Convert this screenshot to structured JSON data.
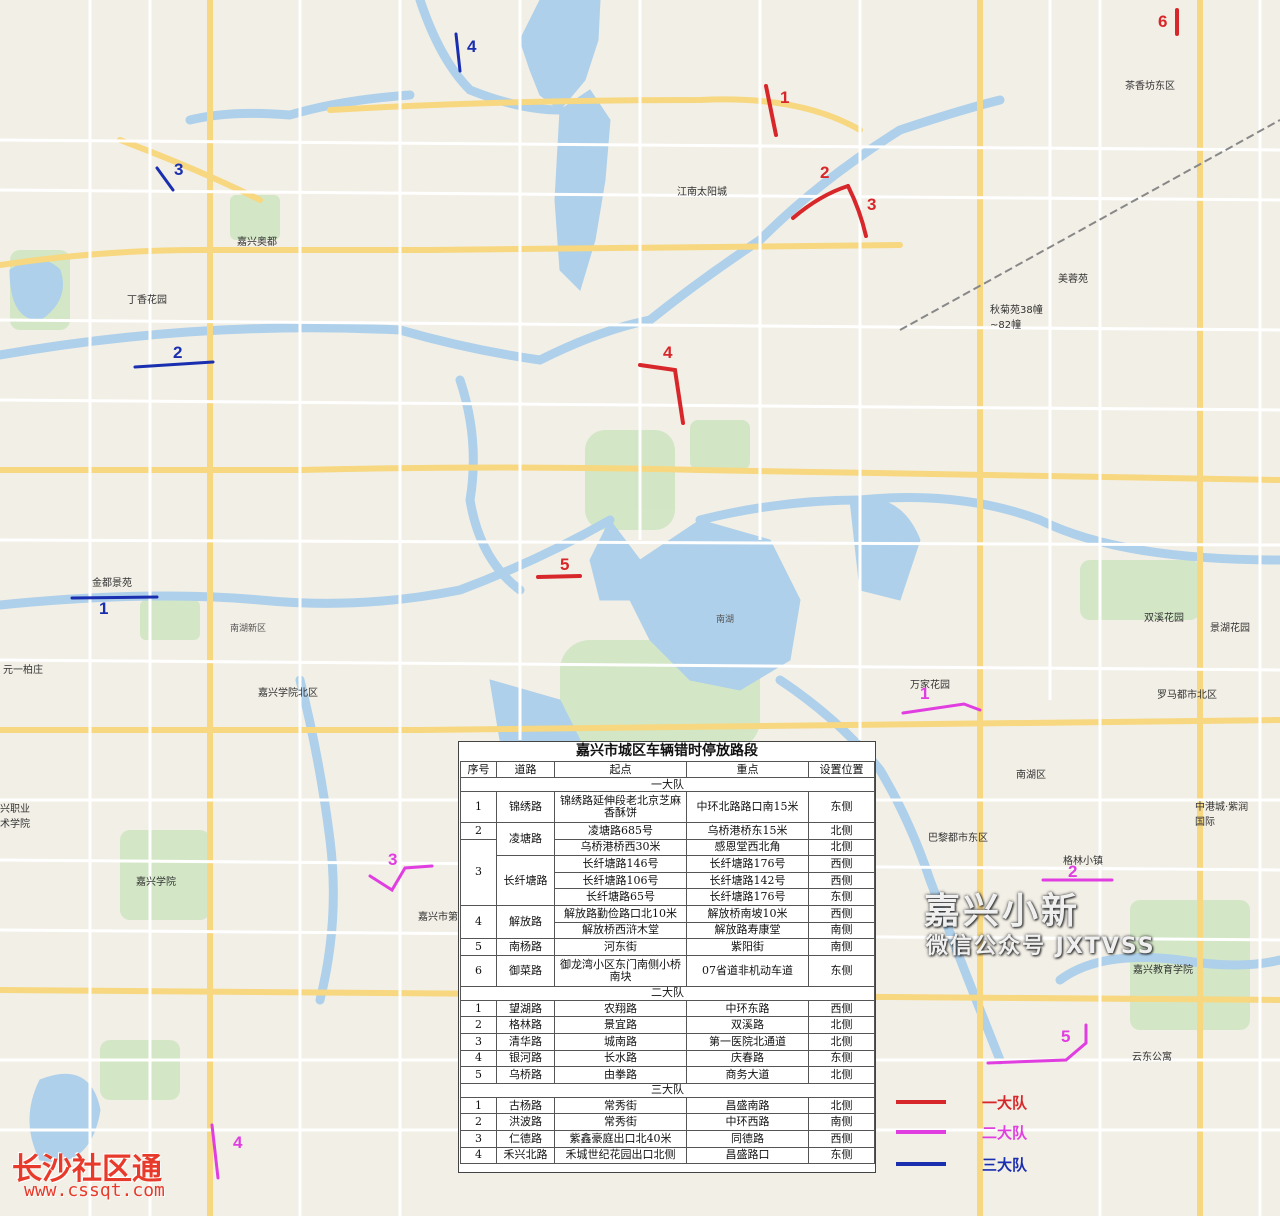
{
  "colors": {
    "team1": "#d8272a",
    "team2": "#e03ee0",
    "team3": "#1a2fb0",
    "water": "#aed0ea",
    "road_major": "#f7d780",
    "road_minor": "#ffffff"
  },
  "map_labels": {
    "l01": "丁香花园",
    "l02": "嘉兴奥都",
    "l03": "金都景苑",
    "l04": "元一柏庄",
    "l05": "嘉兴学院北区",
    "l06": "嘉兴学院",
    "l07": "江南太阳城",
    "l08": "秋菊苑38幢~82幢",
    "l09": "美蓉苑",
    "l10": "茶香坊东区",
    "l11": "万家花园",
    "l12": "罗马都市北区",
    "l13": "双溪花园",
    "l14": "景湖花园",
    "l15": "中港城·紫润国际",
    "l16": "南湖区",
    "l17": "巴黎都市东区",
    "l18": "嘉兴教育学院",
    "l19": "云东公寓",
    "l20": "南湖",
    "l21": "格林小镇",
    "l22": "兴职业术学院",
    "l23": "嘉兴市第一",
    "l24": "南湖新区"
  },
  "route_numbers": {
    "t1_1": "1",
    "t1_2": "2",
    "t1_3": "3",
    "t1_4": "4",
    "t1_5": "5",
    "t1_6": "6",
    "t2_1": "1",
    "t2_2": "2",
    "t2_3": "3",
    "t2_4": "4",
    "t2_5": "5",
    "t3_1": "1",
    "t3_2": "2",
    "t3_3": "3",
    "t3_4": "4"
  },
  "table": {
    "title": "嘉兴市城区车辆错时停放路段",
    "headers": [
      "序号",
      "道路",
      "起点",
      "重点",
      "设置位置"
    ],
    "section1": "一大队",
    "section2": "二大队",
    "section3": "三大队",
    "rows1": [
      {
        "no": "1",
        "road": "锦绣路",
        "start": "锦绣路延伸段老北京芝麻香酥饼",
        "end": "中环北路路口南15米",
        "pos": "东侧"
      },
      {
        "no": "2",
        "road": "凌塘路",
        "start": "凌塘路685号",
        "end": "乌桥港桥东15米",
        "pos": "北侧"
      },
      {
        "no": "3",
        "road": "长纤塘路",
        "start1": "乌桥港桥西30米",
        "end1": "感恩堂西北角",
        "pos1": "北侧",
        "start2": "长纤塘路146号",
        "end2": "长纤塘路176号",
        "pos2": "西侧",
        "start3": "长纤塘路106号",
        "end3": "长纤塘路142号",
        "pos3": "西侧",
        "start4": "长纤塘路65号",
        "end4": "长纤塘路176号",
        "pos4": "东侧"
      },
      {
        "no": "4",
        "road": "解放路",
        "start1": "解放路勤俭路口北10米",
        "end1": "解放桥南坡10米",
        "pos1": "西侧",
        "start2": "解放桥西浒木堂",
        "end2": "解放路寿康堂",
        "pos2": "南侧"
      },
      {
        "no": "5",
        "road": "南杨路",
        "start": "河东街",
        "end": "紫阳街",
        "pos": "南侧"
      },
      {
        "no": "6",
        "road": "御菜路",
        "start": "御龙湾小区东门南侧小桥南块",
        "end": "07省道非机动车道",
        "pos": "东侧"
      }
    ],
    "rows2": [
      {
        "no": "1",
        "road": "望湖路",
        "start": "农翔路",
        "end": "中环东路",
        "pos": "西侧"
      },
      {
        "no": "2",
        "road": "格林路",
        "start": "景宜路",
        "end": "双溪路",
        "pos": "北侧"
      },
      {
        "no": "3",
        "road": "清华路",
        "start": "城南路",
        "end": "第一医院北通道",
        "pos": "北侧"
      },
      {
        "no": "4",
        "road": "银河路",
        "start": "长水路",
        "end": "庆春路",
        "pos": "东侧"
      },
      {
        "no": "5",
        "road": "乌桥路",
        "start": "由拳路",
        "end": "商务大道",
        "pos": "北侧"
      }
    ],
    "rows3": [
      {
        "no": "1",
        "road": "古杨路",
        "start": "常秀街",
        "end": "昌盛南路",
        "pos": "北侧"
      },
      {
        "no": "2",
        "road": "洪波路",
        "start": "常秀街",
        "end": "中环西路",
        "pos": "南侧"
      },
      {
        "no": "3",
        "road": "仁德路",
        "start": "紫鑫豪庭出口北40米",
        "end": "同德路",
        "pos": "西侧"
      },
      {
        "no": "4",
        "road": "禾兴北路",
        "start": "禾城世纪花园出口北侧",
        "end": "昌盛路口",
        "pos": "东侧"
      }
    ]
  },
  "legend": {
    "team1": "一大队",
    "team2": "二大队",
    "team3": "三大队"
  },
  "watermarks": {
    "brand_cn": "嘉兴小新",
    "brand_sub": "微信公众号 JXTVSS",
    "site_cn": "长沙社区通",
    "site_url": "www.cssqt.com"
  }
}
